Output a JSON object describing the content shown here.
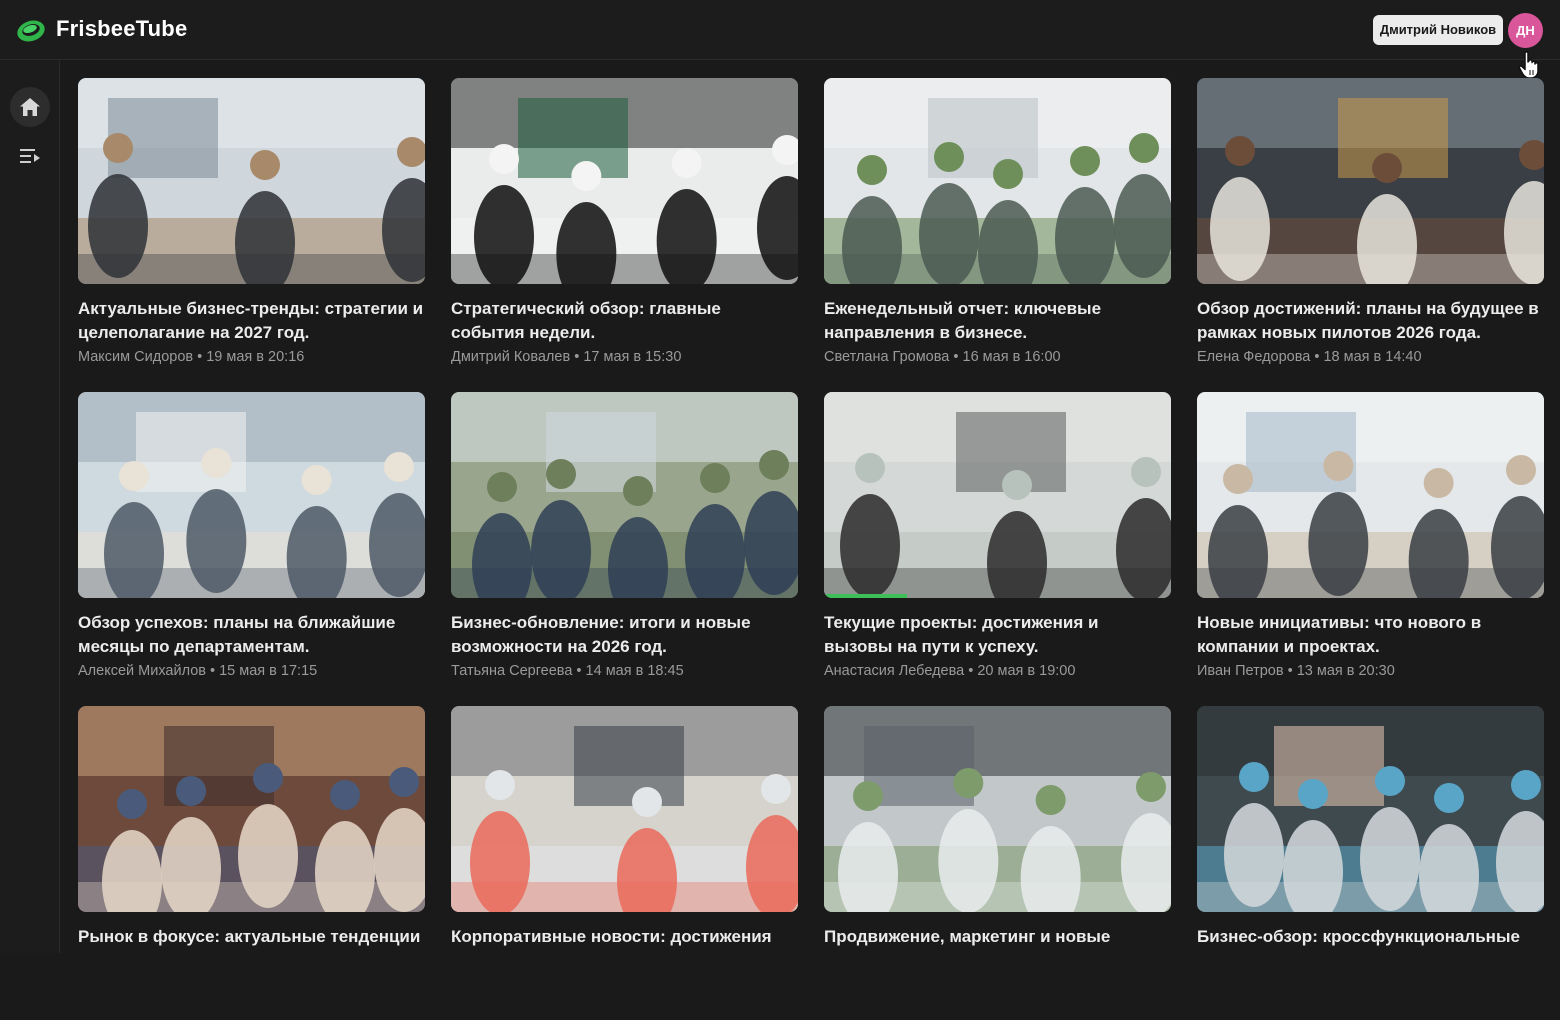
{
  "app": {
    "title": "FrisbeeTube"
  },
  "colors": {
    "accent": "#3fbf59",
    "avatar": "#d9569a",
    "background": "#1a1a1a"
  },
  "header": {
    "user_name": "Дмитрий Новиков",
    "avatar_initials": "ДН"
  },
  "sidebar": {
    "items": [
      {
        "icon": "home-icon"
      },
      {
        "icon": "playlist-icon"
      }
    ]
  },
  "videos": [
    {
      "title": "Актуальные бизнес-тренды: стратегии и целеполагание на 2027 год.",
      "author": "Максим Сидоров",
      "date": "19 мая в 20:16",
      "progress": 0
    },
    {
      "title": "Стратегический обзор: главные события недели.",
      "author": "Дмитрий Ковалев",
      "date": "17 мая в 15:30",
      "progress": 0
    },
    {
      "title": "Еженедельный отчет: ключевые направления в бизнесе.",
      "author": "Светлана Громова",
      "date": "16 мая в 16:00",
      "progress": 0
    },
    {
      "title": "Обзор достижений: планы на будущее в рамках новых пилотов 2026 года.",
      "author": "Елена Федорова",
      "date": "18 мая в 14:40",
      "progress": 0
    },
    {
      "title": "Обзор успехов: планы на ближайшие месяцы по департаментам.",
      "author": "Алексей Михайлов",
      "date": "15 мая в 17:15",
      "progress": 0
    },
    {
      "title": "Бизнес-обновление: итоги и новые возможности на 2026 год.",
      "author": "Татьяна Сергеева",
      "date": "14 мая в 18:45",
      "progress": 0
    },
    {
      "title": "Текущие проекты: достижения и вызовы на пути к успеху.",
      "author": "Анастасия Лебедева",
      "date": "20 мая в 19:00",
      "progress": 24
    },
    {
      "title": "Новые инициативы: что нового в компании и проектах.",
      "author": "Иван Петров",
      "date": "13 мая в 20:30",
      "progress": 0
    },
    {
      "title": "Рынок в фокусе: актуальные тенденции",
      "author": "",
      "date": "",
      "progress": 0
    },
    {
      "title": "Корпоративные новости: достижения",
      "author": "",
      "date": "",
      "progress": 0
    },
    {
      "title": "Продвижение, маркетинг и новые",
      "author": "",
      "date": "",
      "progress": 0
    },
    {
      "title": "Бизнес-обзор: кроссфункциональные",
      "author": "",
      "date": "",
      "progress": 0
    }
  ]
}
